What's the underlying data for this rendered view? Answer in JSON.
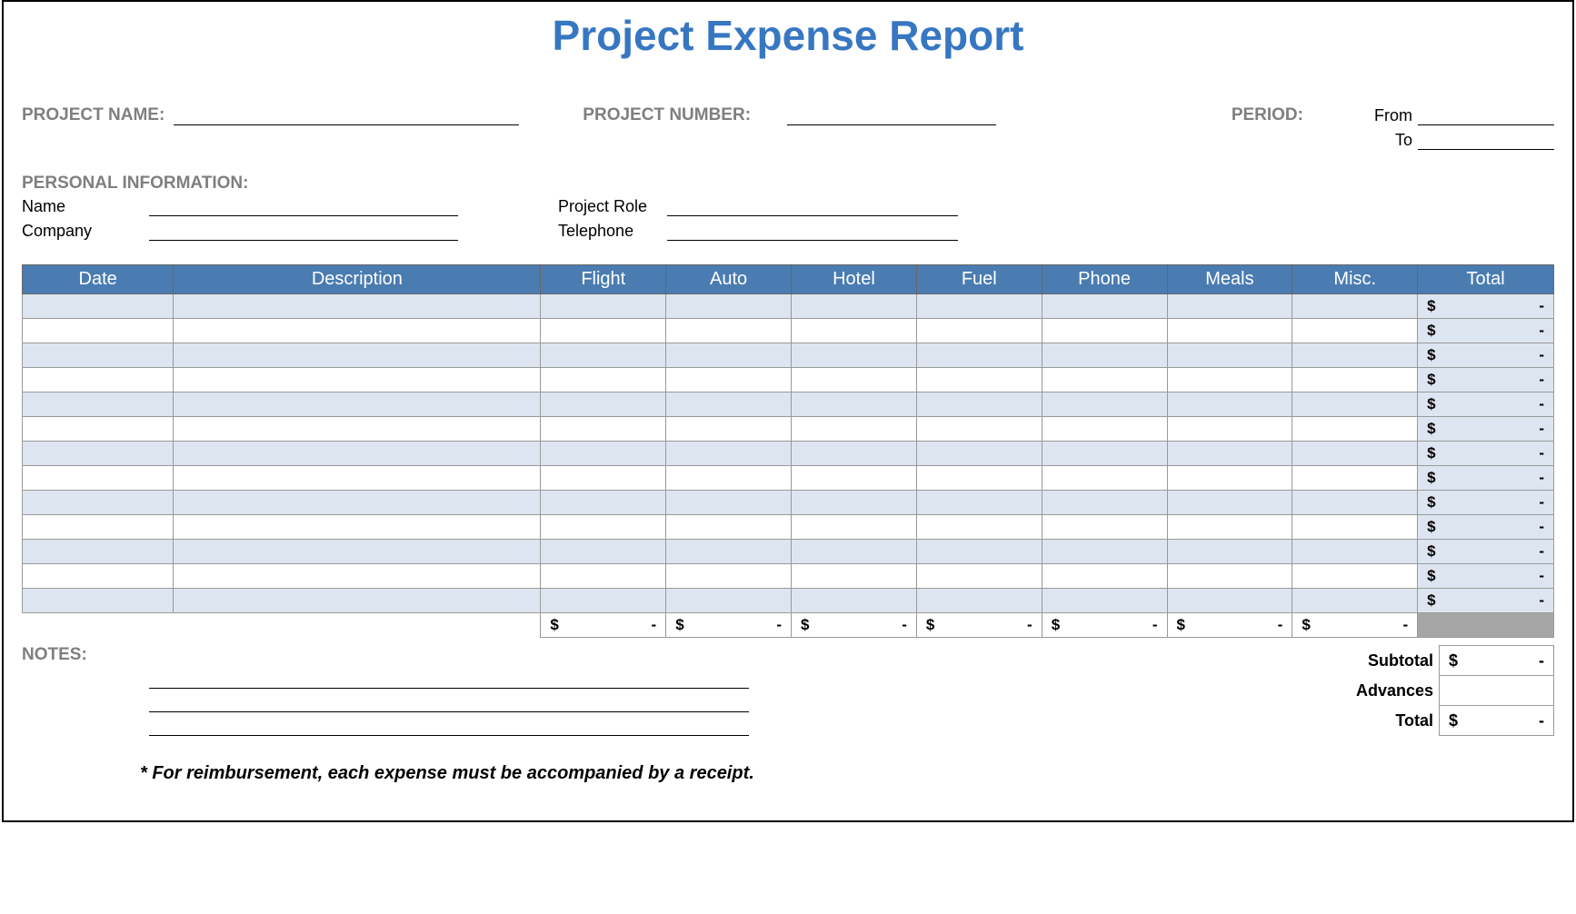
{
  "title": "Project Expense Report",
  "header": {
    "project_name_label": "PROJECT NAME:",
    "project_number_label": "PROJECT NUMBER:",
    "period_label": "PERIOD:",
    "from_label": "From",
    "to_label": "To"
  },
  "personal": {
    "section_label": "PERSONAL INFORMATION:",
    "name_label": "Name",
    "company_label": "Company",
    "role_label": "Project Role",
    "telephone_label": "Telephone"
  },
  "table": {
    "headers": {
      "date": "Date",
      "description": "Description",
      "flight": "Flight",
      "auto": "Auto",
      "hotel": "Hotel",
      "fuel": "Fuel",
      "phone": "Phone",
      "meals": "Meals",
      "misc": "Misc.",
      "total": "Total"
    },
    "currency": "$",
    "dash": "-",
    "row_count": 13
  },
  "summary": {
    "subtotal_label": "Subtotal",
    "advances_label": "Advances",
    "total_label": "Total",
    "notes_label": "NOTES:"
  },
  "footnote": "* For reimbursement, each expense must be accompanied by a receipt."
}
